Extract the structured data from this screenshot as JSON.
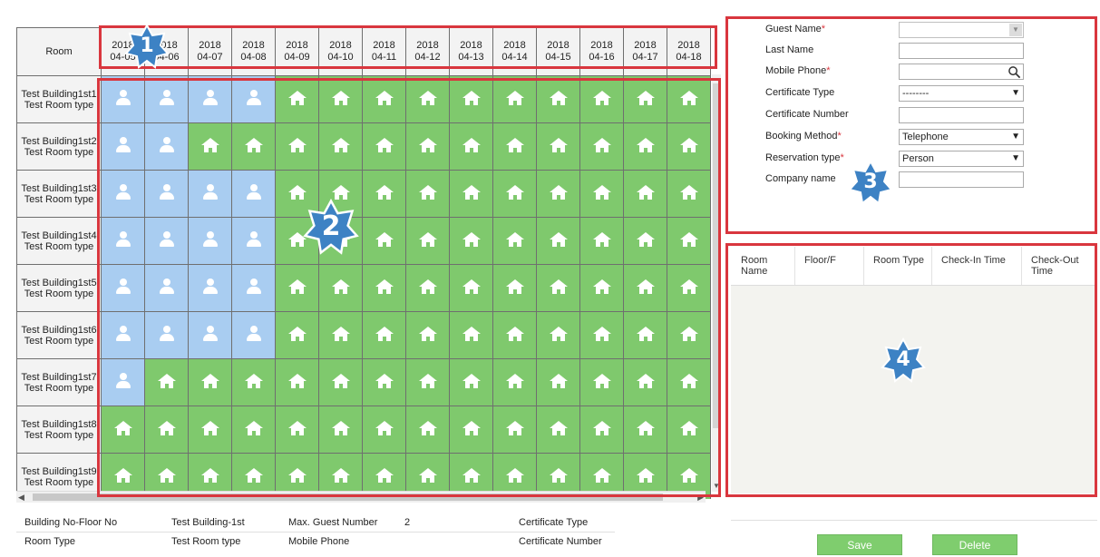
{
  "grid": {
    "room_header": "Room",
    "dates": [
      {
        "year": "2018",
        "md": "04-05"
      },
      {
        "year": "2018",
        "md": "04-06"
      },
      {
        "year": "2018",
        "md": "04-07"
      },
      {
        "year": "2018",
        "md": "04-08"
      },
      {
        "year": "2018",
        "md": "04-09"
      },
      {
        "year": "2018",
        "md": "04-10"
      },
      {
        "year": "2018",
        "md": "04-11"
      },
      {
        "year": "2018",
        "md": "04-12"
      },
      {
        "year": "2018",
        "md": "04-13"
      },
      {
        "year": "2018",
        "md": "04-14"
      },
      {
        "year": "2018",
        "md": "04-15"
      },
      {
        "year": "2018",
        "md": "04-16"
      },
      {
        "year": "2018",
        "md": "04-17"
      },
      {
        "year": "2018",
        "md": "04-18"
      }
    ],
    "rooms": [
      {
        "name": "Test Building1st1",
        "type": "Test Room type",
        "occupied_days": 4
      },
      {
        "name": "Test Building1st2",
        "type": "Test Room type",
        "occupied_days": 2
      },
      {
        "name": "Test Building1st3",
        "type": "Test Room type",
        "occupied_days": 4
      },
      {
        "name": "Test Building1st4",
        "type": "Test Room type",
        "occupied_days": 4
      },
      {
        "name": "Test Building1st5",
        "type": "Test Room type",
        "occupied_days": 4
      },
      {
        "name": "Test Building1st6",
        "type": "Test Room type",
        "occupied_days": 4
      },
      {
        "name": "Test Building1st7",
        "type": "Test Room type",
        "occupied_days": 1
      },
      {
        "name": "Test Building1st8",
        "type": "Test Room type",
        "occupied_days": 0
      },
      {
        "name": "Test Building1st9",
        "type": "Test Room type",
        "occupied_days": 0
      }
    ],
    "occupied_icon": "person-icon",
    "available_icon": "house-icon",
    "colors": {
      "occupied": "#a9cdf1",
      "available": "#7fc96d"
    }
  },
  "badges": {
    "b1": "1",
    "b2": "2",
    "b3": "3",
    "b4": "4"
  },
  "form": {
    "guest_name_label": "Guest Name",
    "last_name_label": "Last Name",
    "mobile_phone_label": "Mobile Phone",
    "certificate_type_label": "Certificate Type",
    "certificate_type_value": "--------",
    "certificate_number_label": "Certificate Number",
    "booking_method_label": "Booking Method",
    "booking_method_value": "Telephone",
    "reservation_type_label": "Reservation type",
    "reservation_type_value": "Person",
    "company_name_label": "Company name",
    "required_mark": "*"
  },
  "list": {
    "col_room_name": "Room Name",
    "col_floor": "Floor/F",
    "col_room_type": "Room Type",
    "col_check_in": "Check-In Time",
    "col_check_out": "Check-Out Time"
  },
  "details": {
    "building_floor_label": "Building No-Floor No",
    "building_floor_value": "Test Building-1st",
    "max_guest_label": "Max. Guest Number",
    "max_guest_value": "2",
    "certificate_type_label": "Certificate Type",
    "room_type_label": "Room Type",
    "room_type_value": "Test Room type",
    "mobile_phone_label": "Mobile Phone",
    "certificate_number_label": "Certificate Number"
  },
  "buttons": {
    "save": "Save",
    "delete": "Delete"
  },
  "accent": {
    "frame": "#d9363e",
    "badge": "#3d82c4",
    "button": "#7fcd6e"
  }
}
